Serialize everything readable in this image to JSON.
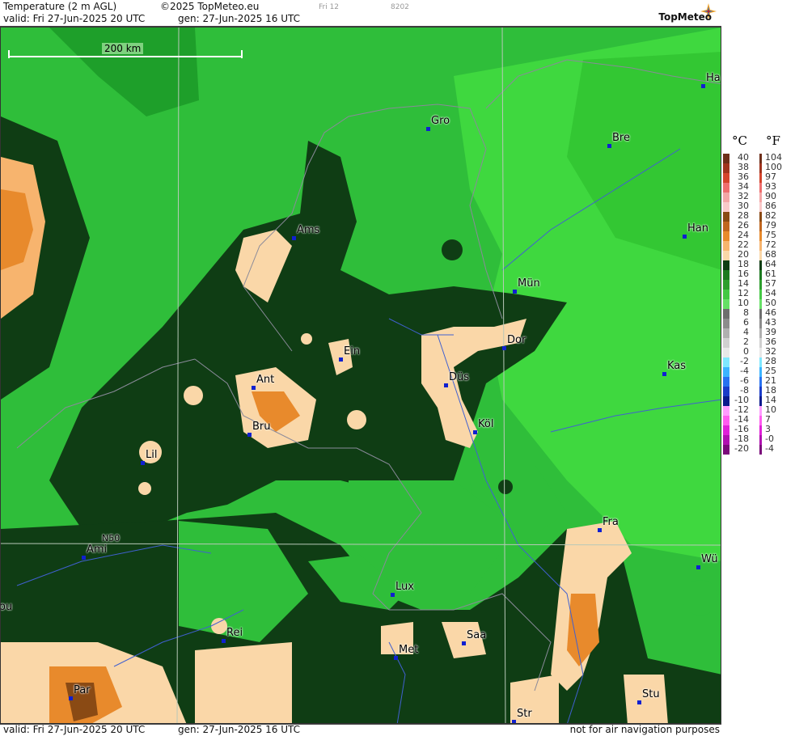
{
  "header": {
    "title": "Temperature (2 m AGL)",
    "copyright": "©2025 TopMeteo.eu",
    "frame_label": "Fri 12",
    "code": "8202",
    "valid": "valid:  Fri  27-Jun-2025  20 UTC",
    "generated": "gen:  27-Jun-2025 16 UTC",
    "brand": "TopMeteo"
  },
  "footer": {
    "valid": "valid:  Fri  27-Jun-2025  20 UTC",
    "generated": "gen:  27-Jun-2025 16 UTC",
    "disclaimer": "not for air navigation purposes"
  },
  "map": {
    "scale_label": "200 km",
    "lat_label": "N50",
    "cities": [
      {
        "name": "Gro"
      },
      {
        "name": "Bre"
      },
      {
        "name": "Ha"
      },
      {
        "name": "Ams"
      },
      {
        "name": "Han"
      },
      {
        "name": "Mün"
      },
      {
        "name": "Ein"
      },
      {
        "name": "Dor"
      },
      {
        "name": "Kas"
      },
      {
        "name": "Ant"
      },
      {
        "name": "Düs"
      },
      {
        "name": "Bru"
      },
      {
        "name": "Köl"
      },
      {
        "name": "Lil"
      },
      {
        "name": "Ami"
      },
      {
        "name": "Fra"
      },
      {
        "name": "Wü"
      },
      {
        "name": "Lux"
      },
      {
        "name": "ou"
      },
      {
        "name": "Rei"
      },
      {
        "name": "Saa"
      },
      {
        "name": "Met"
      },
      {
        "name": "Par"
      },
      {
        "name": "Stu"
      },
      {
        "name": "Str"
      }
    ]
  },
  "legend": {
    "unit_c": "°C",
    "unit_f": "°F",
    "celsius": [
      "40",
      "38",
      "36",
      "34",
      "32",
      "30",
      "28",
      "26",
      "24",
      "22",
      "20",
      "18",
      "16",
      "14",
      "12",
      "10",
      "8",
      "6",
      "4",
      "2",
      "0",
      "-2",
      "-4",
      "-6",
      "-8",
      "-10",
      "-12",
      "-14",
      "-16",
      "-18",
      "-20"
    ],
    "fahrenheit": [
      "104",
      "100",
      "97",
      "93",
      "90",
      "86",
      "82",
      "79",
      "75",
      "72",
      "68",
      "64",
      "61",
      "57",
      "54",
      "50",
      "46",
      "43",
      "39",
      "36",
      "32",
      "28",
      "25",
      "21",
      "18",
      "14",
      "10",
      "7",
      "3",
      "-0",
      "-4"
    ],
    "colors": [
      "#6e2f1a",
      "#a0341e",
      "#d4442c",
      "#ee6e6e",
      "#f4a6a6",
      "#f9c9c9",
      "#8a4a14",
      "#c0661f",
      "#e88a2c",
      "#f7b46e",
      "#fad7a8",
      "#0f3d14",
      "#1c7a20",
      "#2e9e2e",
      "#44c844",
      "#66e066",
      "#6e6e6e",
      "#8c8c8c",
      "#b0b0b0",
      "#d0d0d0",
      "#e8e8e8",
      "#7fe8ff",
      "#3cb4ff",
      "#2872f0",
      "#1a3cc8",
      "#0a1a8c",
      "#ff9cff",
      "#ff5cf0",
      "#e020d8",
      "#b010b0",
      "#7a0a7a"
    ]
  }
}
